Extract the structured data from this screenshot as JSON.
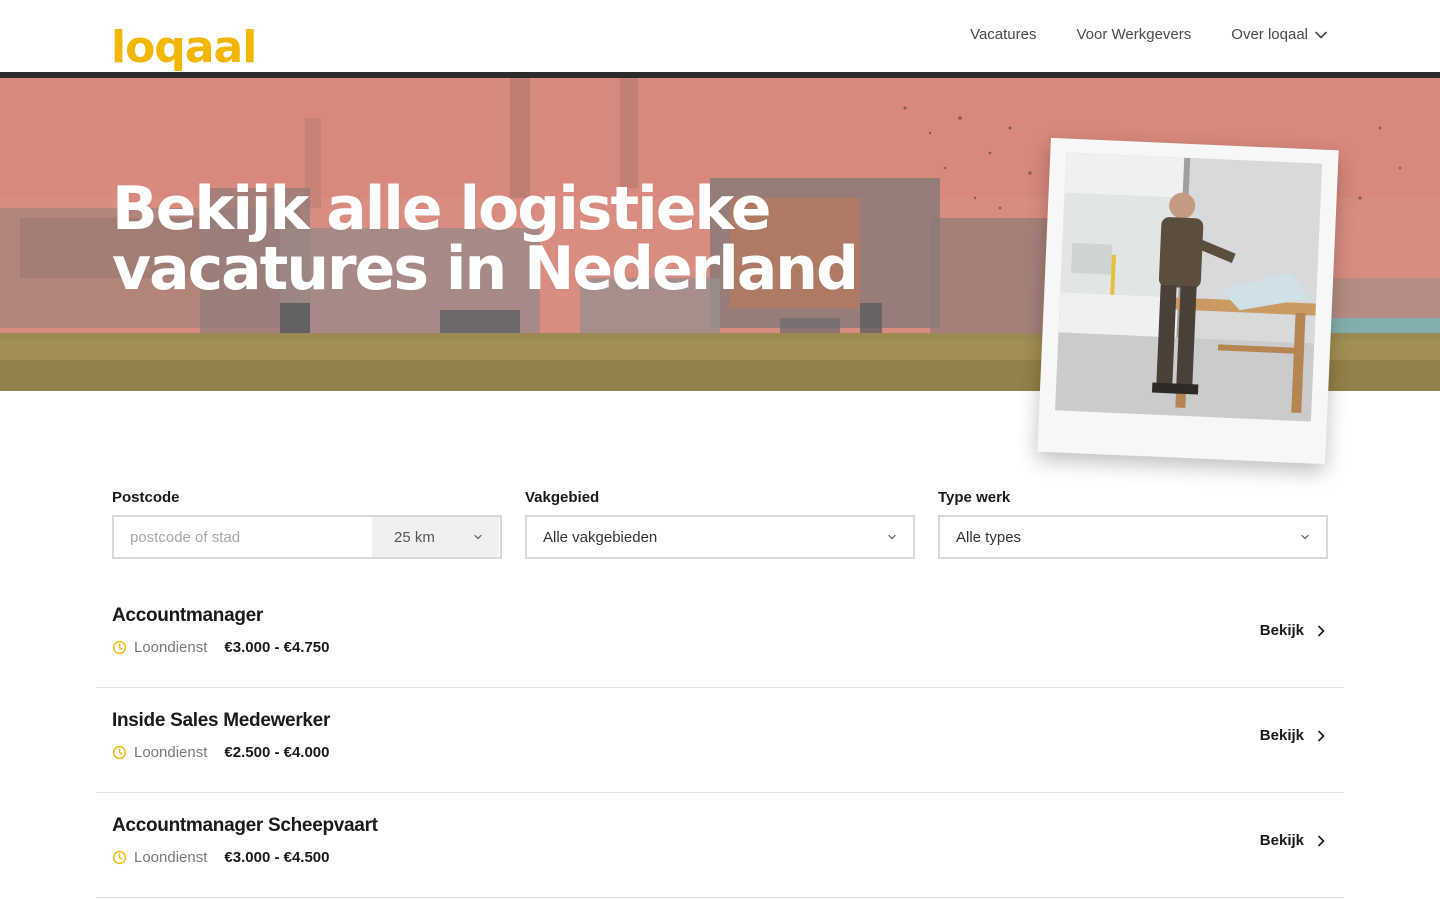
{
  "brand": {
    "logo_text": "loqaal",
    "accent": "#f2b705"
  },
  "nav": {
    "items": [
      {
        "label": "Vacatures"
      },
      {
        "label": "Voor Werkgevers"
      },
      {
        "label": "Over loqaal",
        "icon": "chevron-down-icon"
      }
    ]
  },
  "hero": {
    "title_line1": "Bekijk alle logistieke",
    "title_line2": "vacatures in Nederland"
  },
  "filters": {
    "postcode": {
      "label": "Postcode",
      "placeholder": "postcode of stad",
      "value": "",
      "radius": "25 km"
    },
    "vakgebied": {
      "label": "Vakgebied",
      "value": "Alle vakgebieden"
    },
    "type_werk": {
      "label": "Type werk",
      "value": "Alle types"
    }
  },
  "jobs": [
    {
      "title": "Accountmanager",
      "type": "Loondienst",
      "salary": "€3.000 - €4.750",
      "link": "Bekijk"
    },
    {
      "title": "Inside Sales Medewerker",
      "type": "Loondienst",
      "salary": "€2.500 - €4.000",
      "link": "Bekijk"
    },
    {
      "title": "Accountmanager Scheepvaart",
      "type": "Loondienst",
      "salary": "€3.000 - €4.500",
      "link": "Bekijk"
    }
  ]
}
